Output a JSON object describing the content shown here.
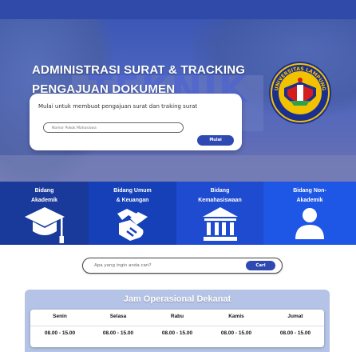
{
  "hero": {
    "title_line1": "ADMINISTRASI SURAT & TRACKING",
    "title_line2": "PENGAJUAN DOKUMEN",
    "card": {
      "description": "Mulai untuk membuat pengajuan surat dan traking surat",
      "input_placeholder": "Nomor Pokok Mahasiswa",
      "button_label": "Mulai"
    },
    "background_sign": "TEKNIK"
  },
  "categories": [
    {
      "line1": "Bidang",
      "line2": "Akademik",
      "icon": "graduation-cap-icon",
      "color": "#1a3a9b"
    },
    {
      "line1": "Bidang Umum",
      "line2": "& Keuangan",
      "icon": "handshake-icon",
      "color": "#1540b8"
    },
    {
      "line1": "Bidang",
      "line2": "Kemahasiswaan",
      "icon": "institution-icon",
      "color": "#1e4bd0"
    },
    {
      "line1": "Bidang Non-",
      "line2": "Akademik",
      "icon": "user-icon",
      "color": "#1e56e5"
    }
  ],
  "search": {
    "placeholder": "Apa yang ingin anda cari?",
    "button_label": "Cari"
  },
  "hours": {
    "title": "Jam Operasional Dekanat",
    "days": [
      {
        "day": "Senin",
        "hours": "08.00 - 15.00"
      },
      {
        "day": "Selasa",
        "hours": "08.00 - 15.00"
      },
      {
        "day": "Rabu",
        "hours": "08.00 - 15.00"
      },
      {
        "day": "Kamis",
        "hours": "08.00 - 15.00"
      },
      {
        "day": "Jumat",
        "hours": "08.00 - 15.00"
      }
    ]
  },
  "logo": {
    "text": "UNIVERSITAS LAMPUNG"
  },
  "colors": {
    "primary": "#2f49b3",
    "topbar": "#2f4aa8",
    "hours_panel": "#b4c3e6"
  }
}
